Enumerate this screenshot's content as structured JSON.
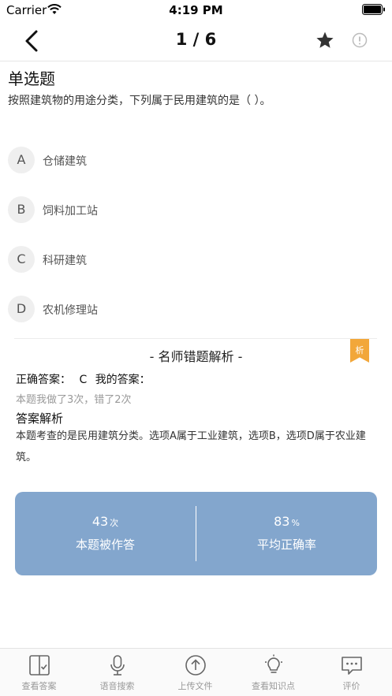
{
  "status_bar": {
    "carrier": "Carrier",
    "time": "4:19 PM"
  },
  "nav": {
    "title": "1 / 6",
    "back_icon": "chevron-left-icon",
    "favorite_icon": "star-icon",
    "report_icon": "info-circle-icon"
  },
  "question": {
    "type": "单选题",
    "text": "按照建筑物的用途分类，下列属于民用建筑的是（    ）。",
    "options": [
      {
        "letter": "A",
        "text": "仓储建筑"
      },
      {
        "letter": "B",
        "text": "饲料加工站"
      },
      {
        "letter": "C",
        "text": "科研建筑"
      },
      {
        "letter": "D",
        "text": "农机修理站"
      }
    ]
  },
  "analysis": {
    "title": "- 名师错题解析 -",
    "badge": "析",
    "correct_label": "正确答案：",
    "correct_value": "C",
    "my_answer_label": "我的答案：",
    "attempts": "本题我做了3次，错了2次",
    "explain_title": "答案解析",
    "explain_text": "本题考查的是民用建筑分类。选项A属于工业建筑，选项B，选项D属于农业建筑。"
  },
  "stats": {
    "attempts_value": "43",
    "attempts_unit": "次",
    "attempts_label": "本题被作答",
    "accuracy_value": "83",
    "accuracy_unit": "%",
    "accuracy_label": "平均正确率",
    "card_color": "#83a6cd"
  },
  "tabs": [
    {
      "label": "查看答案",
      "icon": "answer-book-icon"
    },
    {
      "label": "语音搜索",
      "icon": "microphone-icon"
    },
    {
      "label": "上传文件",
      "icon": "upload-icon"
    },
    {
      "label": "查看知识点",
      "icon": "lightbulb-icon"
    },
    {
      "label": "评价",
      "icon": "comment-icon"
    }
  ],
  "colors": {
    "badge": "#f2a73a",
    "tab_text": "#999999"
  }
}
